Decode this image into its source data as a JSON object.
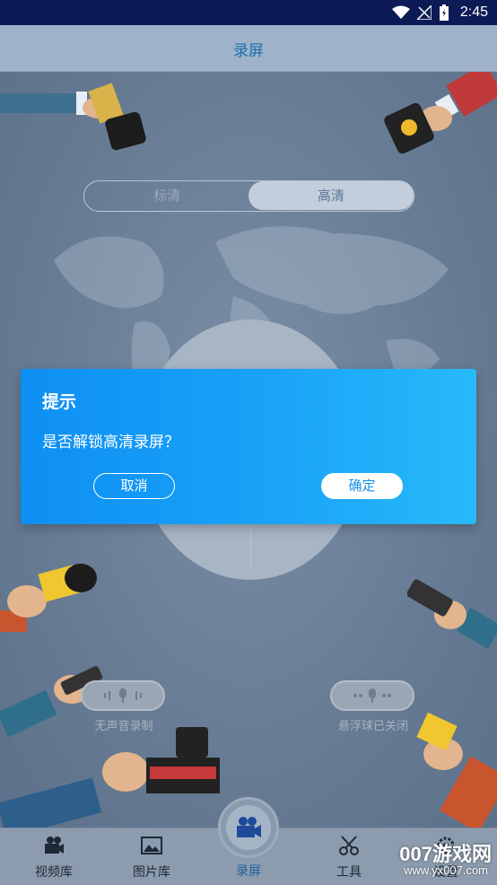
{
  "status_bar": {
    "time": "2:45"
  },
  "header": {
    "title": "录屏"
  },
  "quality": {
    "sd_label": "标清",
    "hd_label": "高清",
    "selected": "高清"
  },
  "mic_buttons": [
    {
      "label": "无声音录制"
    },
    {
      "label": "悬浮球已关闭"
    }
  ],
  "dialog": {
    "title": "提示",
    "message": "是否解锁高清录屏？",
    "cancel_label": "取消",
    "confirm_label": "确定"
  },
  "bottom_nav": {
    "items": [
      {
        "label": "视频库",
        "icon": "film-camera-icon"
      },
      {
        "label": "图片库",
        "icon": "image-icon"
      },
      {
        "label": "录屏",
        "icon": "video-camera-icon",
        "active": true
      },
      {
        "label": "工具",
        "icon": "scissors-icon"
      },
      {
        "label": "设置",
        "icon": "gear-icon"
      }
    ]
  },
  "watermark": {
    "brand": "007游戏网",
    "url": "www.yx007.com"
  },
  "colors": {
    "accent": "#1d6fb1",
    "dialog_start": "#0e8ff3",
    "dialog_end": "#27baf8",
    "status_bar": "#0c1b55"
  }
}
